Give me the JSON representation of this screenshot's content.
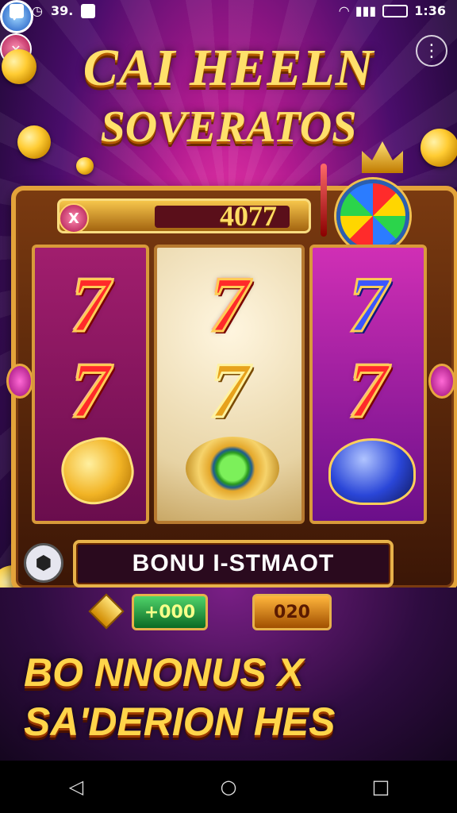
{
  "status_bar": {
    "left_text": "39.",
    "time": "1:36",
    "icons": [
      "mail-icon",
      "clock-icon",
      "photo-icon",
      "wifi-icon",
      "signal-icon",
      "battery-icon"
    ]
  },
  "game": {
    "title_line1": "CAI HEELN",
    "title_line2": "SOVERATOS",
    "score": "4077",
    "bonus_label": "BONU I-STMAOT",
    "green_value": "+000",
    "orange_value": "020",
    "reels": [
      [
        "7",
        "7",
        "coin"
      ],
      [
        "7",
        "7",
        "emerald"
      ],
      [
        "7",
        "7",
        "sapphire"
      ]
    ],
    "promo_line1": "BO NNONUS X",
    "promo_line2": "SA'DERION HES"
  },
  "colors": {
    "title_gold": "#ffe06b",
    "frame_gold": "#e3a33a",
    "promo_gold": "#ffd54a"
  },
  "navbar": {
    "back": "◁",
    "home": "○",
    "recent": "□"
  }
}
